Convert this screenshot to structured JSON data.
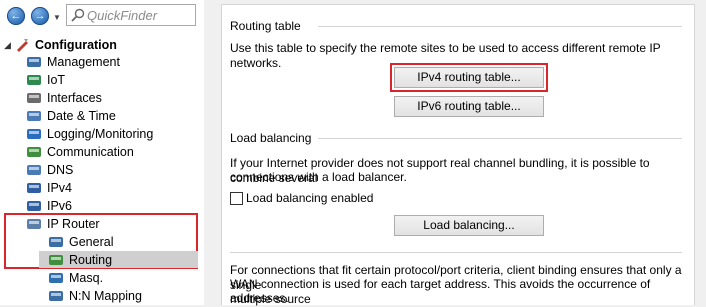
{
  "toolbar": {
    "back_label": "←",
    "forward_label": "→",
    "search_placeholder": "QuickFinder"
  },
  "tree": {
    "root_label": "Configuration",
    "items": [
      {
        "label": "Management",
        "icon": "management-icon"
      },
      {
        "label": "IoT",
        "icon": "iot-icon"
      },
      {
        "label": "Interfaces",
        "icon": "interfaces-icon"
      },
      {
        "label": "Date & Time",
        "icon": "clock-icon"
      },
      {
        "label": "Logging/Monitoring",
        "icon": "monitoring-icon"
      },
      {
        "label": "Communication",
        "icon": "communication-icon"
      },
      {
        "label": "DNS",
        "icon": "dns-icon"
      },
      {
        "label": "IPv4",
        "icon": "ipv4-icon"
      },
      {
        "label": "IPv6",
        "icon": "ipv6-icon"
      },
      {
        "label": "IP Router",
        "icon": "router-icon"
      },
      {
        "label": "General",
        "icon": "general-icon"
      },
      {
        "label": "Routing",
        "icon": "routing-icon"
      },
      {
        "label": "Masq.",
        "icon": "masq-icon"
      },
      {
        "label": "N:N Mapping",
        "icon": "nn-mapping-icon"
      }
    ]
  },
  "routing_table": {
    "title": "Routing table",
    "description": "Use this table to specify the remote sites to be used to access different remote IP networks.",
    "ipv4_button": "IPv4 routing table...",
    "ipv6_button": "IPv6 routing table..."
  },
  "load_balancing": {
    "title": "Load balancing",
    "description_line1": "If your Internet provider does not support real channel bundling, it is possible to combine several",
    "description_line2": "connections with a load balancer.",
    "checkbox_label": "Load balancing enabled",
    "checkbox_checked": false,
    "button": "Load balancing...",
    "binding_line1": "For connections that fit certain protocol/port criteria, client binding ensures that only a single",
    "binding_line2": "WAN connection is used for each target address. This avoids the occurrence of multiple source",
    "binding_line3": "addresses."
  },
  "colors": {
    "highlight": "#d9262c",
    "selected_row": "#cfcfcf"
  }
}
